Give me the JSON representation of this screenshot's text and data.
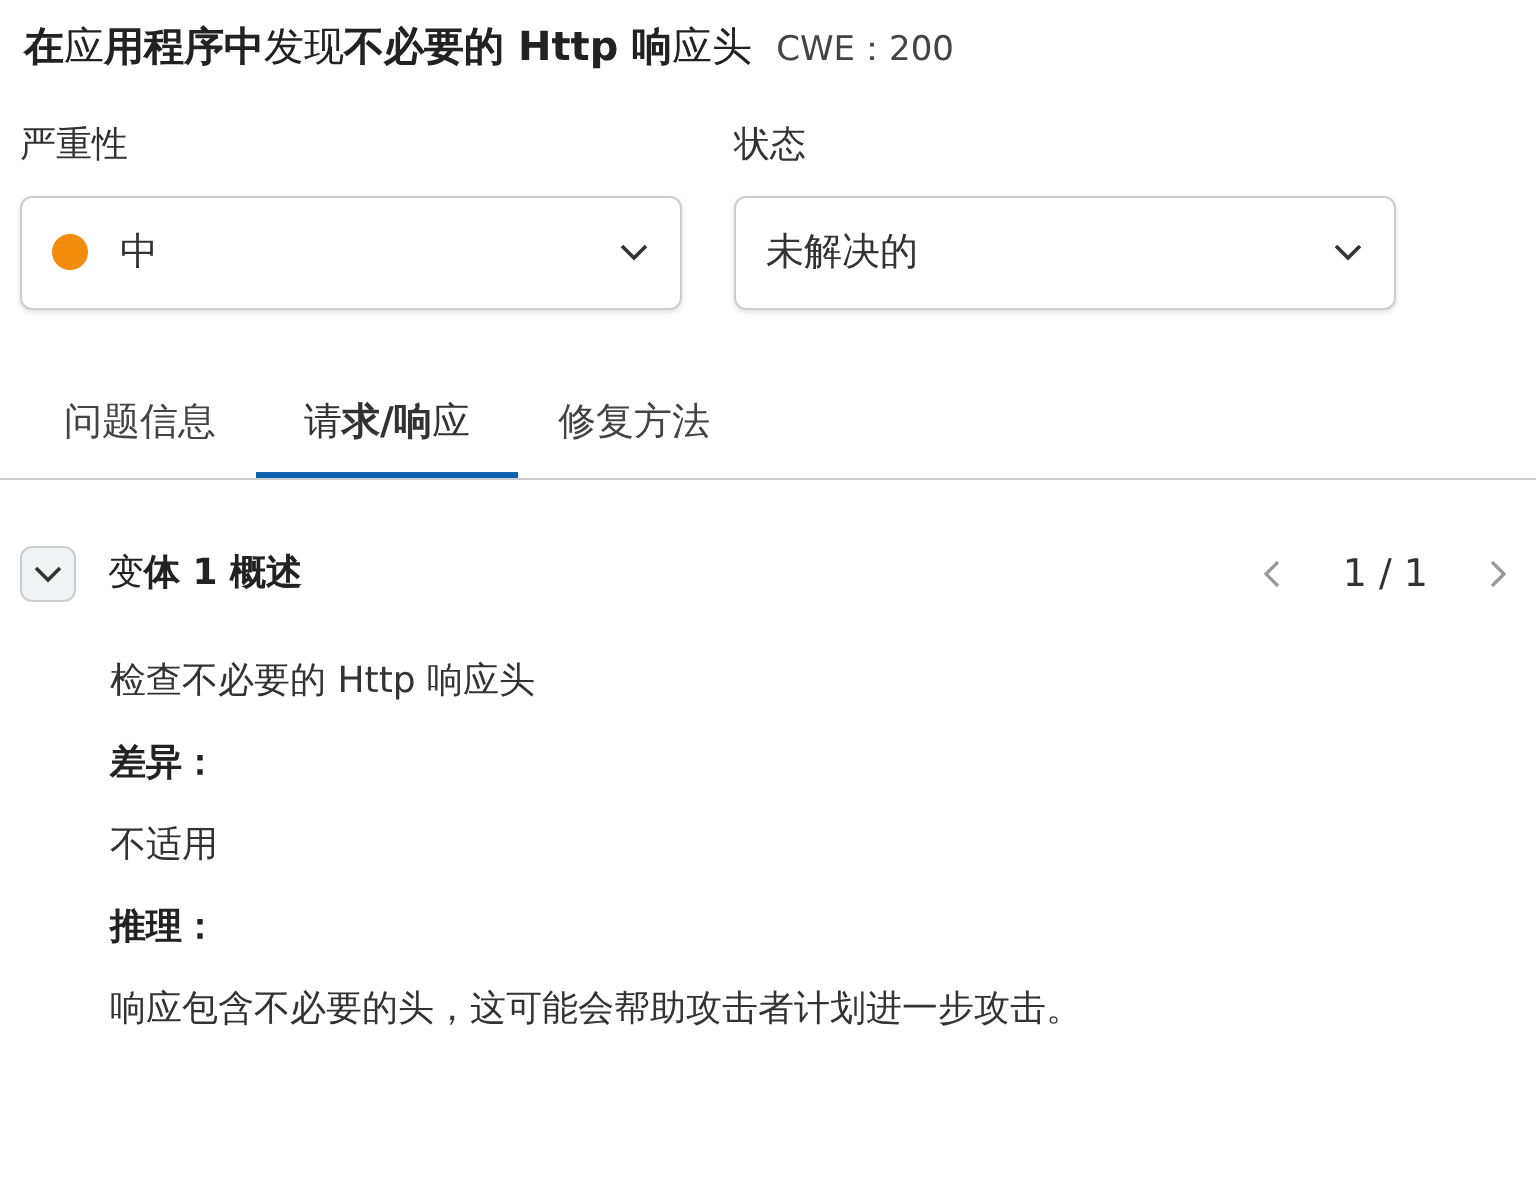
{
  "title": "**在**应**用程序中**发现**不必要的 Http 响**应头",
  "cwe": "CWE：200",
  "fields": [
    {
      "label": "严重性",
      "value": "中",
      "color": "#f28c0c"
    },
    {
      "label": "状态",
      "value": "未解决的"
    }
  ],
  "tabs": [
    {
      "label": "问题信息",
      "selected": false
    },
    {
      "label": "请**求/响**应",
      "selected": true
    },
    {
      "label": "修复方法",
      "selected": false
    }
  ],
  "variant": {
    "title": "变**体 1 概述**",
    "expanded": true,
    "pager": "1 / 1",
    "items": [
      {
        "kind": "text",
        "text": "检查不必要的 Http 响应头"
      },
      {
        "kind": "heading",
        "text": "差异："
      },
      {
        "kind": "text",
        "text": "不适用"
      },
      {
        "kind": "heading",
        "text": "推理："
      },
      {
        "kind": "text",
        "text": "响应包含不必要的头，这可能会帮助攻击者计划进一步攻击。"
      }
    ]
  }
}
